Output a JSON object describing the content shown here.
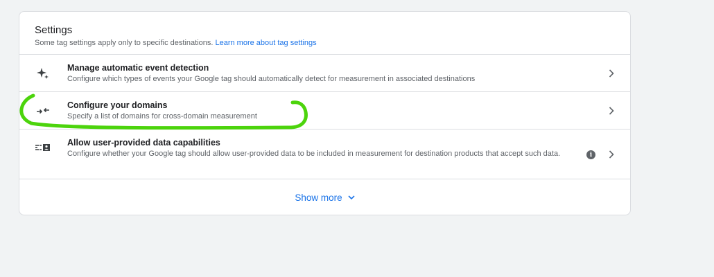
{
  "settings": {
    "title": "Settings",
    "subtitle": "Some tag settings apply only to specific destinations.",
    "learn_more": "Learn more about tag settings",
    "rows": [
      {
        "title": "Manage automatic event detection",
        "description": "Configure which types of events your Google tag should automatically detect for measurement in associated destinations",
        "icon": "sparkle-icon"
      },
      {
        "title": "Configure your domains",
        "description": "Specify a list of domains for cross-domain measurement",
        "icon": "merge-arrows-icon"
      },
      {
        "title": "Allow user-provided data capabilities",
        "description": "Configure whether your Google tag should allow user-provided data to be included in measurement for destination products that accept such data.",
        "icon": "user-data-icon",
        "info_glyph": "i"
      }
    ],
    "show_more": "Show more"
  },
  "colors": {
    "link": "#1a73e8",
    "annotation": "#4cd40c",
    "background": "#f1f3f4"
  }
}
